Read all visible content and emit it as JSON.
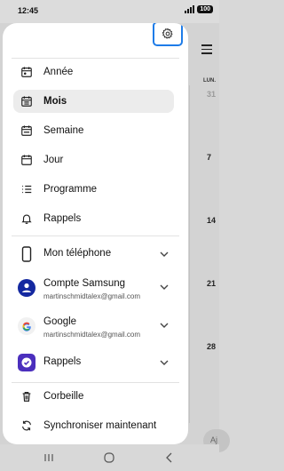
{
  "status": {
    "time": "12:45",
    "battery": "100"
  },
  "calendar_bg": {
    "day_header": "LUN.",
    "dates": [
      "31",
      "7",
      "14",
      "21",
      "28"
    ],
    "fab_text": "Aj"
  },
  "drawer": {
    "views": [
      {
        "label": "Année",
        "icon": "calendar-icon"
      },
      {
        "label": "Mois",
        "icon": "calendar-icon",
        "selected": true
      },
      {
        "label": "Semaine",
        "icon": "calendar-icon"
      },
      {
        "label": "Jour",
        "icon": "calendar-icon"
      },
      {
        "label": "Programme",
        "icon": "list-icon"
      },
      {
        "label": "Rappels",
        "icon": "bell-icon"
      }
    ],
    "accounts": [
      {
        "title": "Mon téléphone",
        "sub": "",
        "icon": "phone-icon"
      },
      {
        "title": "Compte Samsung",
        "sub": "martinschmidtalex@gmail.com",
        "icon": "samsung-account-icon"
      },
      {
        "title": "Google",
        "sub": "martinschmidtalex@gmail.com",
        "icon": "google-icon"
      },
      {
        "title": "Rappels",
        "sub": "",
        "icon": "reminder-check-icon"
      }
    ],
    "bottom": [
      {
        "label": "Corbeille",
        "icon": "trash-icon"
      },
      {
        "label": "Synchroniser maintenant",
        "icon": "sync-icon"
      }
    ]
  },
  "colors": {
    "accent": "#1e7ce8",
    "samsung": "#1428a0",
    "reminder": "#4b2fbd"
  }
}
